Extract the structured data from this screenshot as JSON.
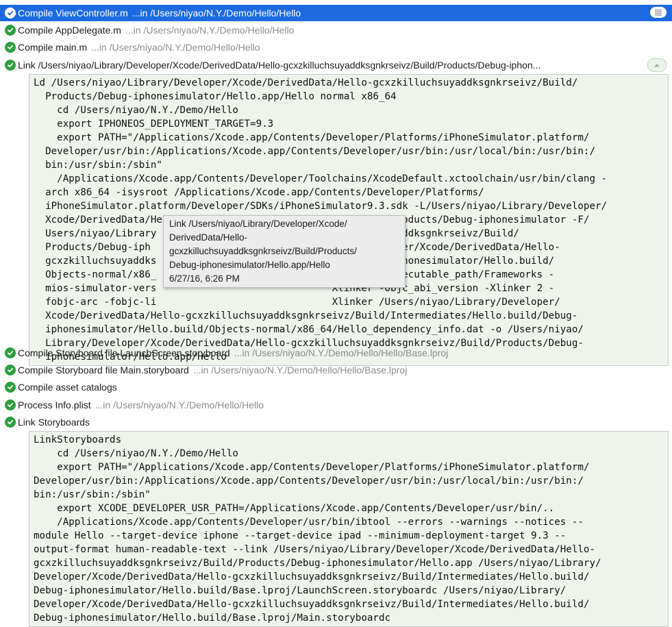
{
  "steps": [
    {
      "title": "Compile ViewController.m",
      "detail": "...in /Users/niyao/N.Y./Demo/Hello/Hello",
      "selected": true
    },
    {
      "title": "Compile AppDelegate.m",
      "detail": "...in /Users/niyao/N.Y./Demo/Hello/Hello"
    },
    {
      "title": "Compile main.m",
      "detail": "...in /Users/niyao/N.Y./Demo/Hello/Hello"
    },
    {
      "title": "Link /Users/niyao/Library/Developer/Xcode/DerivedData/Hello-gcxzkilluchsuyaddksgnkrseivz/Build/Products/Debug-iphon...",
      "detail": ""
    },
    {
      "title": "Compile Storyboard file LaunchScreen.storyboard",
      "detail": "...in /Users/niyao/N.Y./Demo/Hello/Hello/Base.lproj"
    },
    {
      "title": "Compile Storyboard file Main.storyboard",
      "detail": "...in /Users/niyao/N.Y./Demo/Hello/Hello/Base.lproj"
    },
    {
      "title": "Compile asset catalogs",
      "detail": ""
    },
    {
      "title": "Process Info.plist",
      "detail": "...in /Users/niyao/N.Y./Demo/Hello/Hello"
    },
    {
      "title": "Link Storyboards",
      "detail": ""
    }
  ],
  "link_log": [
    "Ld /Users/niyao/Library/Developer/Xcode/DerivedData/Hello-gcxzkilluchsuyaddksgnkrseivz/Build/",
    "  Products/Debug-iphonesimulator/Hello.app/Hello normal x86_64",
    "    cd /Users/niyao/N.Y./Demo/Hello",
    "    export IPHONEOS_DEPLOYMENT_TARGET=9.3",
    "    export PATH=\"/Applications/Xcode.app/Contents/Developer/Platforms/iPhoneSimulator.platform/",
    "  Developer/usr/bin:/Applications/Xcode.app/Contents/Developer/usr/bin:/usr/local/bin:/usr/bin:/",
    "  bin:/usr/sbin:/sbin\"",
    "    /Applications/Xcode.app/Contents/Developer/Toolchains/XcodeDefault.xctoolchain/usr/bin/clang -",
    "  arch x86_64 -isysroot /Applications/Xcode.app/Contents/Developer/Platforms/",
    "  iPhoneSimulator.platform/Developer/SDKs/iPhoneSimulator9.3.sdk -L/Users/niyao/Library/Developer/",
    "  Xcode/DerivedData/Hello-gcxzkilluchsuyaddksgnkrseivz/Build/Products/Debug-iphonesimulator -F/",
    "  Users/niyao/Library                              zkilluchsuyaddksgnkrseivz/Build/",
    "  Products/Debug-iph                               rary/Developer/Xcode/DerivedData/Hello-",
    "  gcxzkilluchsuyaddks                              ild/Debug-iphonesimulator/Hello.build/",
    "  Objects-normal/x86_                              -Xlinker @executable_path/Frameworks -",
    "  mios-simulator-vers                              Xlinker -objc_abi_version -Xlinker 2 -",
    "  fobjc-arc -fobjc-li                              Xlinker /Users/niyao/Library/Developer/",
    "  Xcode/DerivedData/Hello-gcxzkilluchsuyaddksgnkrseivz/Build/Intermediates/Hello.build/Debug-",
    "  iphonesimulator/Hello.build/Objects-normal/x86_64/Hello_dependency_info.dat -o /Users/niyao/",
    "  Library/Developer/Xcode/DerivedData/Hello-gcxzkilluchsuyaddksgnkrseivz/Build/Products/Debug-",
    "  iphonesimulator/Hello.app/Hello"
  ],
  "storyboards_log": [
    "LinkStoryboards",
    "    cd /Users/niyao/N.Y./Demo/Hello",
    "    export PATH=\"/Applications/Xcode.app/Contents/Developer/Platforms/iPhoneSimulator.platform/",
    "Developer/usr/bin:/Applications/Xcode.app/Contents/Developer/usr/bin:/usr/local/bin:/usr/bin:/",
    "bin:/usr/sbin:/sbin\"",
    "    export XCODE_DEVELOPER_USR_PATH=/Applications/Xcode.app/Contents/Developer/usr/bin/..",
    "    /Applications/Xcode.app/Contents/Developer/usr/bin/ibtool --errors --warnings --notices --",
    "module Hello --target-device iphone --target-device ipad --minimum-deployment-target 9.3 --",
    "output-format human-readable-text --link /Users/niyao/Library/Developer/Xcode/DerivedData/Hello-",
    "gcxzkilluchsuyaddksgnkrseivz/Build/Products/Debug-iphonesimulator/Hello.app /Users/niyao/Library/",
    "Developer/Xcode/DerivedData/Hello-gcxzkilluchsuyaddksgnkrseivz/Build/Intermediates/Hello.build/",
    "Debug-iphonesimulator/Hello.build/Base.lproj/LaunchScreen.storyboardc /Users/niyao/Library/",
    "Developer/Xcode/DerivedData/Hello-gcxzkilluchsuyaddksgnkrseivz/Build/Intermediates/Hello.build/",
    "Debug-iphonesimulator/Hello.build/Base.lproj/Main.storyboardc"
  ],
  "tooltip": {
    "lines": [
      "Link /Users/niyao/Library/Developer/Xcode/",
      "DerivedData/Hello-",
      "gcxzkilluchsuyaddksgnkrseivz/Build/Products/",
      "Debug-iphonesimulator/Hello.app/Hello",
      "6/27/16, 6:26 PM"
    ]
  },
  "icons": {
    "step_status": "checkmark-circle-icon",
    "log_toggle": "lines-icon",
    "collapse": "chevron-up-icon"
  },
  "colors": {
    "selection": "#1d6ae0",
    "success": "#2f9e3f",
    "log_background": "#eef3ec",
    "detail_text": "#8c8c8c"
  }
}
